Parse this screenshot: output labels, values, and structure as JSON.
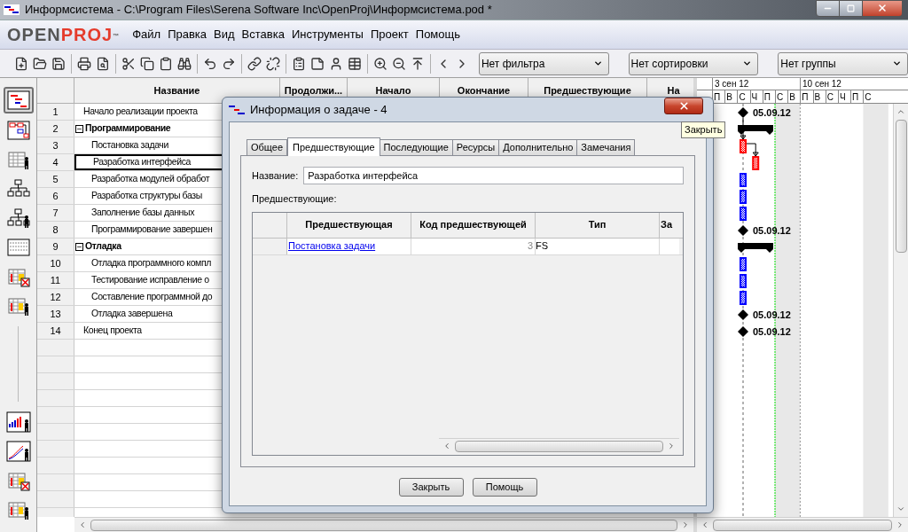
{
  "window": {
    "title": "Информсистема - C:\\Program Files\\Serena Software Inc\\OpenProj\\Информсистема.pod *"
  },
  "logo": {
    "part_1": "OPEN",
    "part_2": "PROJ",
    "mark": "™"
  },
  "menu": [
    "Файл",
    "Правка",
    "Вид",
    "Вставка",
    "Инструменты",
    "Проект",
    "Помощь"
  ],
  "toolbar": {
    "dropdowns": [
      "Нет фильтра",
      "Нет сортировки",
      "Нет группы"
    ]
  },
  "views": [
    {
      "kind": "gantt",
      "selected": true
    },
    {
      "kind": "network",
      "selected": false
    },
    {
      "kind": "resource_table",
      "selected": false
    },
    {
      "kind": "wbs",
      "selected": false
    },
    {
      "kind": "rbs",
      "selected": false
    },
    {
      "kind": "grid",
      "selected": false
    },
    {
      "kind": "table_cross",
      "selected": false
    },
    {
      "kind": "table_person",
      "selected": false
    },
    {
      "kind": "histogram",
      "selected": false
    },
    {
      "kind": "curve",
      "selected": false
    },
    {
      "kind": "table_cross",
      "selected": false
    },
    {
      "kind": "table_person",
      "selected": false
    }
  ],
  "table": {
    "columns": [
      "Название",
      "Продолжи...",
      "Начало",
      "Окончание",
      "Предшествующие",
      "На"
    ],
    "rows": [
      {
        "number": "1",
        "name": "Начало реализации проекта",
        "summary": false,
        "selected": false,
        "children": []
      },
      {
        "number": "2",
        "name": "Программирование",
        "summary": true,
        "selected": false,
        "children": [
          {
            "number": "3",
            "name": "Постановка задачи",
            "summary": false,
            "selected": false
          },
          {
            "number": "4",
            "name": "Разработка интерфейса",
            "summary": false,
            "selected": true
          },
          {
            "number": "5",
            "name": "Разработка модулей обработ",
            "summary": false,
            "selected": false
          },
          {
            "number": "6",
            "name": "Разработка структуры  базы",
            "summary": false,
            "selected": false
          },
          {
            "number": "7",
            "name": "Заполнение базы данных",
            "summary": false,
            "selected": false
          },
          {
            "number": "8",
            "name": "Программирование завершен",
            "summary": false,
            "selected": false
          }
        ]
      },
      {
        "number": "9",
        "name": "Отладка",
        "summary": true,
        "selected": false,
        "children": [
          {
            "number": "10",
            "name": "Отладка программного компл",
            "summary": false,
            "selected": false
          },
          {
            "number": "11",
            "name": "Тестирование исправление о",
            "summary": false,
            "selected": false
          },
          {
            "number": "12",
            "name": "Составление программной до",
            "summary": false,
            "selected": false
          },
          {
            "number": "13",
            "name": "Отладка завершена",
            "summary": false,
            "selected": false
          }
        ]
      },
      {
        "number": "14",
        "name": "Конец проекта",
        "summary": false,
        "selected": false,
        "children": []
      }
    ]
  },
  "gantt": {
    "weeks": [
      "3 сен 12",
      "10 сен 12"
    ],
    "days": [
      "П",
      "В",
      "С",
      "Ч",
      "П",
      "С",
      "В",
      "П",
      "В",
      "С",
      "Ч",
      "П",
      "С"
    ],
    "bars": [
      {
        "kind": "milestone",
        "label": "05.09.12"
      },
      {
        "kind": "summary"
      },
      {
        "kind": "task",
        "color": "#ff0000",
        "linked": true
      },
      {
        "kind": "task",
        "color": "#ff0000",
        "linked": true
      },
      {
        "kind": "task",
        "color": "#0000ff"
      },
      {
        "kind": "task",
        "color": "#0000ff"
      },
      {
        "kind": "task",
        "color": "#0000ff"
      },
      {
        "kind": "milestone",
        "label": "05.09.12"
      },
      {
        "kind": "summary"
      },
      {
        "kind": "task",
        "color": "#0000ff"
      },
      {
        "kind": "task",
        "color": "#0000ff"
      },
      {
        "kind": "task",
        "color": "#0000ff"
      },
      {
        "kind": "milestone",
        "label": "05.09.12"
      },
      {
        "kind": "milestone",
        "label": "05.09.12"
      }
    ]
  },
  "dialog": {
    "title": "Информация о задаче - 4",
    "tabs": [
      {
        "label": "Общее",
        "selected": false
      },
      {
        "label": "Предшествующие",
        "selected": true
      },
      {
        "label": "Последующие",
        "selected": false
      },
      {
        "label": "Ресурсы",
        "selected": false
      },
      {
        "label": "Дополнительно",
        "selected": false
      },
      {
        "label": "Замечания",
        "selected": false
      }
    ],
    "name_label": "Название:",
    "name_value": "Разработка интерфейса",
    "list_label": "Предшествующие:",
    "columns": [
      "Предшествующая",
      "Код предшествующей",
      "Тип",
      "За"
    ],
    "rows": [
      {
        "predecessor": "Постановка задачи",
        "code": "3",
        "type": "FS"
      }
    ],
    "buttons": [
      "Закрыть",
      "Помощь"
    ]
  },
  "tooltip": "Закрыть"
}
